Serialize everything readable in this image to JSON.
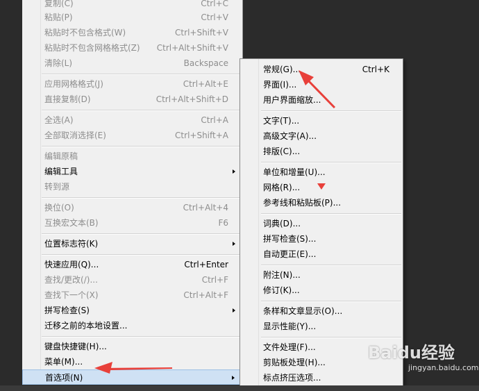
{
  "main_menu": {
    "items": [
      {
        "label": "复制(C)",
        "shortcut": "Ctrl+C",
        "enabled": false
      },
      {
        "label": "粘贴(P)",
        "shortcut": "Ctrl+V",
        "enabled": false
      },
      {
        "label": "粘贴时不包含格式(W)",
        "shortcut": "Ctrl+Shift+V",
        "enabled": false
      },
      {
        "label": "粘贴时不包含网格格式(Z)",
        "shortcut": "Ctrl+Alt+Shift+V",
        "enabled": false
      },
      {
        "label": "清除(L)",
        "shortcut": "Backspace",
        "enabled": false
      },
      {
        "label": "应用网格格式(J)",
        "shortcut": "Ctrl+Alt+E",
        "enabled": false
      },
      {
        "label": "直接复制(D)",
        "shortcut": "Ctrl+Alt+Shift+D",
        "enabled": false
      },
      {
        "label": "全选(A)",
        "shortcut": "Ctrl+A",
        "enabled": false
      },
      {
        "label": "全部取消选择(E)",
        "shortcut": "Ctrl+Shift+A",
        "enabled": false
      },
      {
        "label": "编辑原稿",
        "shortcut": "",
        "enabled": false
      },
      {
        "label": "编辑工具",
        "shortcut": "",
        "enabled": true,
        "submenu": true
      },
      {
        "label": "转到源",
        "shortcut": "",
        "enabled": false
      },
      {
        "label": "换位(O)",
        "shortcut": "Ctrl+Alt+4",
        "enabled": false
      },
      {
        "label": "互换宏文本(B)",
        "shortcut": "F6",
        "enabled": false
      },
      {
        "label": "位置标志符(K)",
        "shortcut": "",
        "enabled": true,
        "submenu": true
      },
      {
        "label": "快速应用(Q)...",
        "shortcut": "Ctrl+Enter",
        "enabled": true
      },
      {
        "label": "查找/更改(/)...",
        "shortcut": "Ctrl+F",
        "enabled": false
      },
      {
        "label": "查找下一个(X)",
        "shortcut": "Ctrl+Alt+F",
        "enabled": false
      },
      {
        "label": "拼写检查(S)",
        "shortcut": "",
        "enabled": true,
        "submenu": true
      },
      {
        "label": "迁移之前的本地设置...",
        "shortcut": "",
        "enabled": true
      },
      {
        "label": "键盘快捷键(H)...",
        "shortcut": "",
        "enabled": true
      },
      {
        "label": "菜单(M)...",
        "shortcut": "",
        "enabled": true
      },
      {
        "label": "首选项(N)",
        "shortcut": "",
        "enabled": true,
        "submenu": true,
        "highlight": true
      }
    ]
  },
  "sub_menu": {
    "items": [
      {
        "label": "常规(G)...",
        "shortcut": "Ctrl+K"
      },
      {
        "label": "界面(I)...",
        "shortcut": ""
      },
      {
        "label": "用户界面缩放...",
        "shortcut": ""
      },
      {
        "label": "文字(T)...",
        "shortcut": ""
      },
      {
        "label": "高级文字(A)...",
        "shortcut": ""
      },
      {
        "label": "排版(C)...",
        "shortcut": ""
      },
      {
        "label": "单位和增量(U)...",
        "shortcut": ""
      },
      {
        "label": "网格(R)...",
        "shortcut": ""
      },
      {
        "label": "参考线和粘贴板(P)...",
        "shortcut": ""
      },
      {
        "label": "词典(D)...",
        "shortcut": ""
      },
      {
        "label": "拼写检查(S)...",
        "shortcut": ""
      },
      {
        "label": "自动更正(E)...",
        "shortcut": ""
      },
      {
        "label": "附注(N)...",
        "shortcut": ""
      },
      {
        "label": "修订(K)...",
        "shortcut": ""
      },
      {
        "label": "条样和文章显示(O)...",
        "shortcut": ""
      },
      {
        "label": "显示性能(Y)...",
        "shortcut": ""
      },
      {
        "label": "文件处理(F)...",
        "shortcut": ""
      },
      {
        "label": "剪贴板处理(H)...",
        "shortcut": ""
      },
      {
        "label": "标点挤压选项...",
        "shortcut": ""
      }
    ]
  },
  "watermark": {
    "brand": "Baidu经验",
    "url": "jingyan.baidu.com"
  },
  "colors": {
    "annotation": "#e8403a",
    "highlight": "#cfe1f4"
  }
}
